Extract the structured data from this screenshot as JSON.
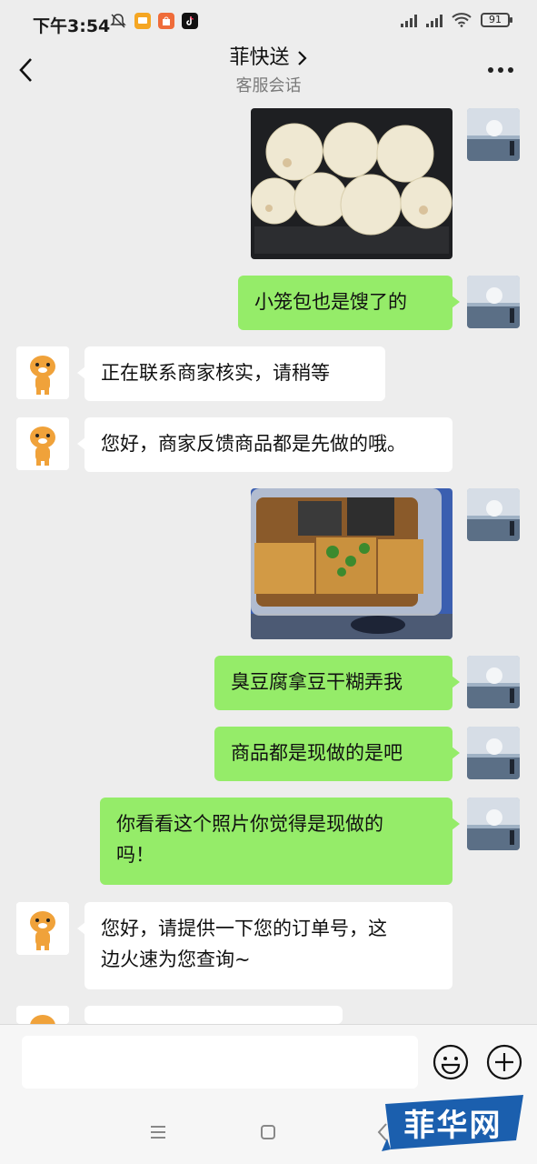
{
  "status_bar": {
    "time": "下午3:54",
    "battery": "91",
    "icons": [
      "bell-off-icon",
      "message-app-icon",
      "shop-app-icon",
      "tiktok-icon",
      "signal-icon",
      "wifi-icon",
      "battery-icon"
    ]
  },
  "header": {
    "title": "菲快送",
    "subtitle": "客服会话",
    "back_icon": "back-arrow-icon",
    "more_icon": "more-dots-icon"
  },
  "messages": [
    {
      "sender": "self",
      "type": "image",
      "description_icon": "photo-buns"
    },
    {
      "sender": "self",
      "type": "text",
      "text": "小笼包也是馊了的"
    },
    {
      "sender": "agent",
      "type": "text",
      "text": "正在联系商家核实，请稍等"
    },
    {
      "sender": "agent",
      "type": "text",
      "text": "您好，商家反馈商品都是先做的哦。"
    },
    {
      "sender": "self",
      "type": "image",
      "description_icon": "photo-tofu"
    },
    {
      "sender": "self",
      "type": "text",
      "text": "臭豆腐拿豆干糊弄我"
    },
    {
      "sender": "self",
      "type": "text",
      "text": "商品都是现做的是吧"
    },
    {
      "sender": "self",
      "type": "text",
      "lines": [
        "你看看这个照片你觉得是现做的",
        "吗！"
      ]
    },
    {
      "sender": "agent",
      "type": "text",
      "lines": [
        "您好，请提供一下您的订单号，这",
        "边火速为您查询~"
      ]
    },
    {
      "sender": "agent",
      "type": "text",
      "text": ""
    }
  ],
  "input_bar": {
    "value": "",
    "emoji_icon": "emoji-icon",
    "plus_icon": "plus-icon"
  },
  "nav_bar": {
    "icons": [
      "menu-icon",
      "home-icon",
      "back-icon"
    ]
  },
  "watermark": {
    "text": "菲华网"
  },
  "colors": {
    "background": "#ededed",
    "self_bubble": "#95ec69",
    "agent_bubble": "#ffffff",
    "watermark": "#1b5fae"
  }
}
